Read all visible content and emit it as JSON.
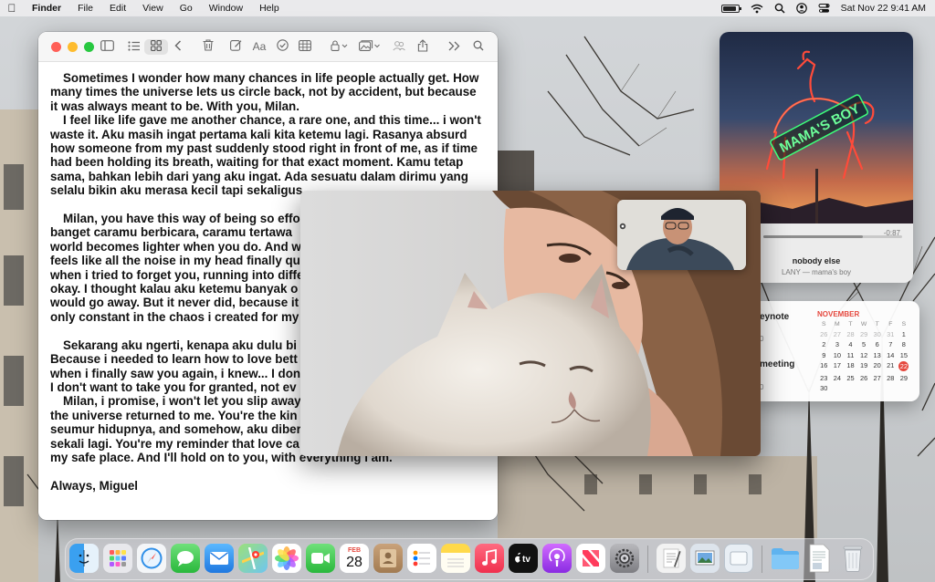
{
  "menubar": {
    "app_name": "Finder",
    "items": [
      "File",
      "Edit",
      "View",
      "Go",
      "Window",
      "Help"
    ],
    "datetime": "Sat Nov 22  9:41 AM"
  },
  "notes": {
    "paragraphs": [
      {
        "indent": true,
        "text": "Sometimes I wonder how many chances in life people actually get. How many times the universe lets us circle back, not by accident, but because it was always meant to be. With you, Milan."
      },
      {
        "indent": true,
        "text": "I feel like life gave me another chance, a rare one, and this time... i won't waste it. Aku masih ingat pertama kali kita ketemu lagi. Rasanya absurd how someone from my past suddenly stood right in front of me, as if time had been holding its breath, waiting for that exact moment. Kamu tetap sama, bahkan lebih dari yang aku ingat. Ada sesuatu dalam dirimu yang selalu bikin aku merasa kecil tapi sekaligus"
      },
      {
        "gap": true
      },
      {
        "indent": true,
        "text": "Milan, you have this way of being so effo"
      },
      {
        "indent": false,
        "text": "banget caramu berbicara, caramu tertawa"
      },
      {
        "indent": false,
        "text": "world becomes lighter when you do. And w"
      },
      {
        "indent": false,
        "text": "feels like all the noise in my head finally qu"
      },
      {
        "indent": false,
        "text": "when i tried to forget you, running into diffe"
      },
      {
        "indent": false,
        "text": "okay. I thought kalau aku ketemu banyak o"
      },
      {
        "indent": false,
        "text": "would go away. But it never did, because it"
      },
      {
        "indent": false,
        "text": "only constant in the chaos i created for my"
      },
      {
        "gap": true
      },
      {
        "indent": true,
        "text": "Sekarang aku ngerti, kenapa aku dulu bi"
      },
      {
        "indent": false,
        "text": "Because i needed to learn how to love bett"
      },
      {
        "indent": false,
        "text": "when i finally saw you again, i knew... I don"
      },
      {
        "indent": false,
        "text": "I don't want to take you for granted, not ev"
      },
      {
        "indent": true,
        "text": "Milan, i promise, i won't let you slip away"
      },
      {
        "indent": false,
        "text": "the universe returned to me. You're the kin"
      },
      {
        "indent": false,
        "text": "seumur hidupnya, and somehow, aku diber"
      },
      {
        "indent": false,
        "text": "sekali lagi. You're my reminder that love ca"
      },
      {
        "indent": false,
        "text": "my safe place. And I'll hold on to you, with everything i am."
      },
      {
        "gap": true
      },
      {
        "indent": false,
        "text": "Always,  Miguel"
      }
    ]
  },
  "music": {
    "remaining": "-0:87",
    "song": "nobody else",
    "artist": "LANY — mama's boy",
    "album_sign": "MAMA'S BOY",
    "progress": 0.72
  },
  "calendar": {
    "event1": "eynote",
    "event1_num": "0",
    "event2": "meeting",
    "event2_num": "0",
    "month": "NOVEMBER",
    "weekdays": [
      "S",
      "M",
      "T",
      "W",
      "T",
      "F",
      "S"
    ],
    "days": [
      "26",
      "27",
      "28",
      "29",
      "30",
      "31",
      "1",
      "2",
      "3",
      "4",
      "5",
      "6",
      "7",
      "8",
      "9",
      "10",
      "11",
      "12",
      "13",
      "14",
      "15",
      "16",
      "17",
      "18",
      "19",
      "20",
      "21",
      "22",
      "23",
      "24",
      "25",
      "26",
      "27",
      "28",
      "29",
      "30"
    ],
    "today": "22"
  },
  "dock": {
    "calendar_month": "FEB",
    "calendar_day": "28",
    "apps": [
      "Finder",
      "Launchpad",
      "Safari",
      "Messages",
      "Mail",
      "Maps",
      "Photos",
      "FaceTime",
      "Calendar",
      "Contacts",
      "Reminders",
      "Notes",
      "Music",
      "TV",
      "Podcasts",
      "News",
      "System Settings",
      "TextEdit",
      "Preview",
      "Screenshot",
      "Folder",
      "Document",
      "Trash"
    ]
  },
  "colors": {
    "close": "#ff5f57",
    "minimize": "#febc2e",
    "zoom": "#28c840",
    "calendar_red": "#e5483e"
  }
}
